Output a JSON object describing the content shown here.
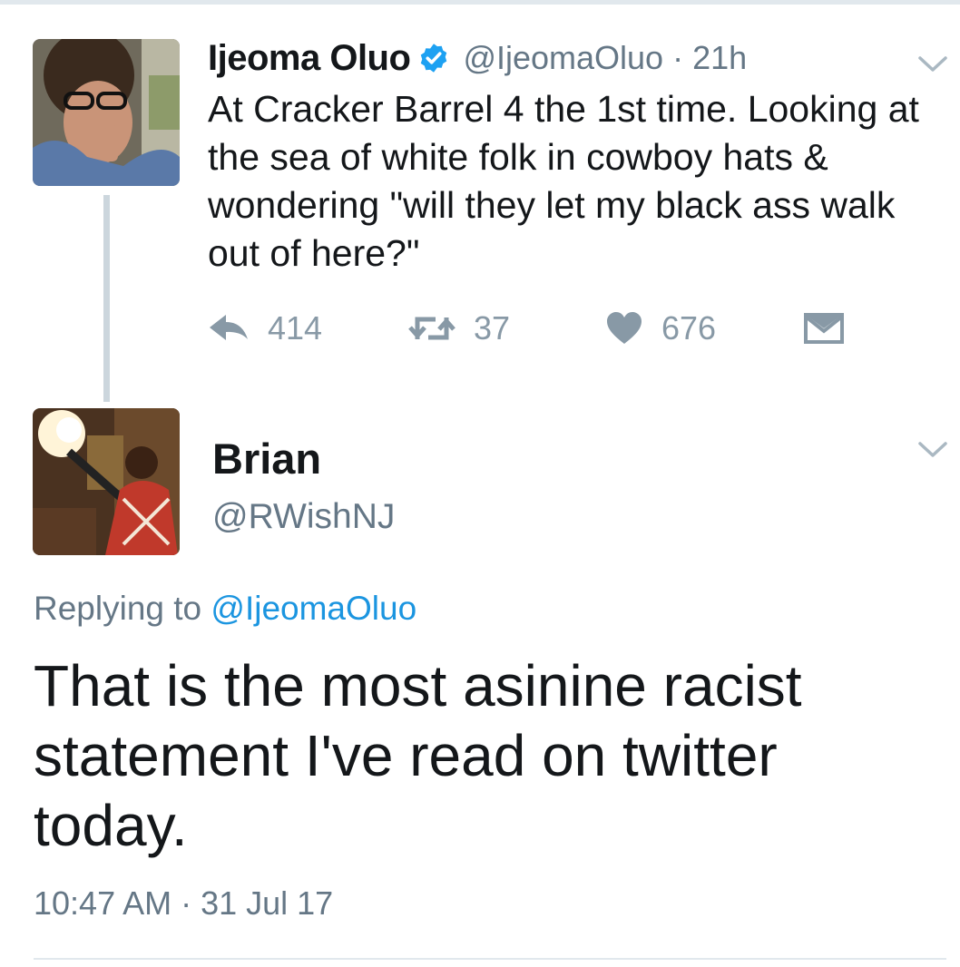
{
  "tweet1": {
    "name": "Ijeoma Oluo",
    "handle": "@IjeomaOluo",
    "time": "21h",
    "separator": "·",
    "text": "At Cracker Barrel 4 the 1st time. Looking at the sea of white folk in cowboy hats & wondering \"will they let my black ass walk out of here?\"",
    "replies": "414",
    "retweets": "37",
    "likes": "676"
  },
  "tweet2": {
    "name": "Brian",
    "handle": "@RWishNJ",
    "replying_label": "Replying to",
    "replying_to": "@IjeomaOluo",
    "text": "That is the most asinine racist statement I've read on twitter today.",
    "timestamp": "10:47 AM · 31 Jul 17"
  },
  "icons": {
    "verified": "verified-badge-icon",
    "reply": "reply-icon",
    "retweet": "retweet-icon",
    "like": "heart-icon",
    "dm": "envelope-icon",
    "caret": "chevron-down-icon"
  },
  "colors": {
    "text": "#14171a",
    "secondary": "#657786",
    "action": "#8899a6",
    "link": "#1b95e0",
    "verified": "#1da1f2",
    "divider": "#e1e8ed",
    "thread": "#ccd6dd"
  }
}
